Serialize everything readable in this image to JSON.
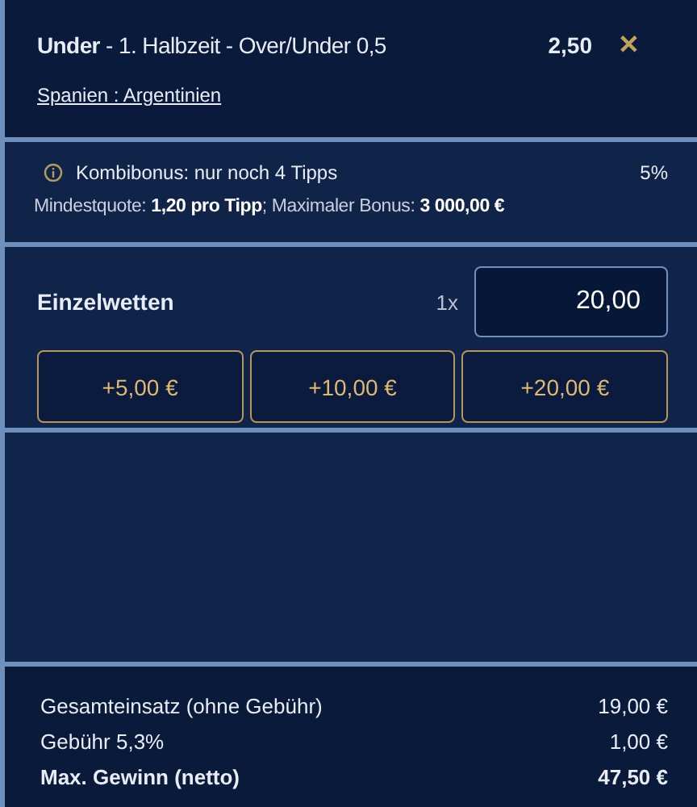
{
  "selection": {
    "title": "**Under** - 1. Halbzeit - Over/Under 0,5",
    "odds": "2,50",
    "close": "✕",
    "match": "Spanien : Argentinien"
  },
  "bonus": {
    "label": "Kombibonus: nur noch 4 Tipps",
    "percent": "5%",
    "details": "Mindestquote: **1,20 pro Tipp**; Maximaler Bonus: **3 000,00 €**"
  },
  "stake": {
    "label": "Einzelwetten",
    "multiplier": "1x",
    "value": "20,00",
    "quick_amounts": [
      "+5,00 €",
      "+10,00 €",
      "+20,00 €"
    ]
  },
  "totals": [
    {
      "label": "Gesamteinsatz (ohne Gebühr)",
      "value": "19,00 €",
      "bold": false
    },
    {
      "label": "Gebühr 5,3%",
      "value": "1,00 €",
      "bold": false
    },
    {
      "label": "Max. Gewinn (netto)",
      "value": "47,50 €",
      "bold": true
    }
  ]
}
